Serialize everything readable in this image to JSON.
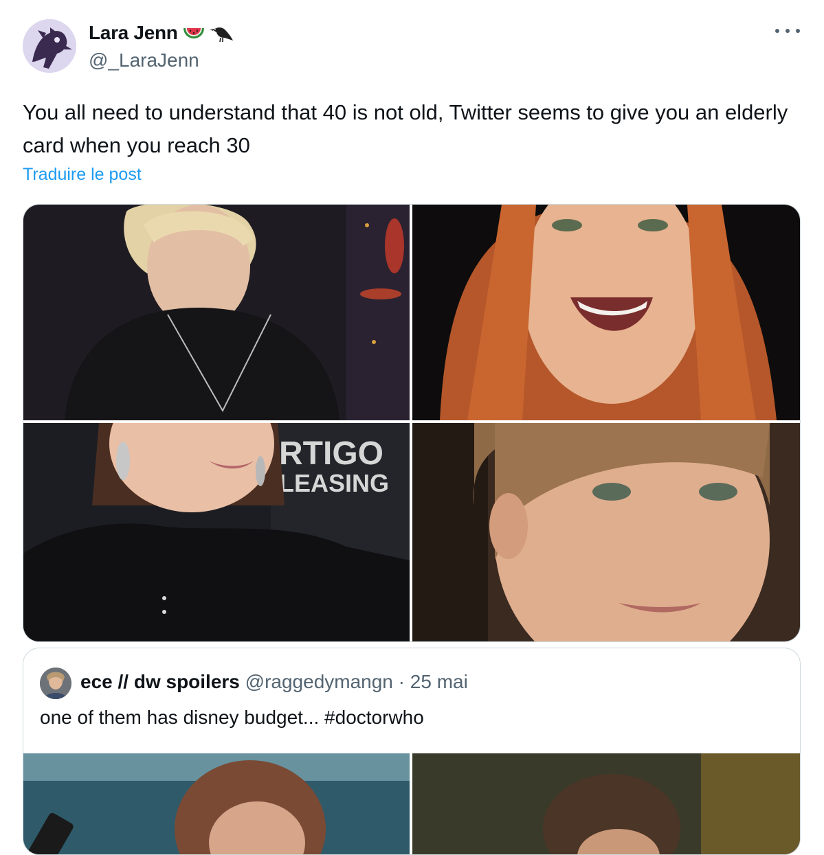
{
  "author": {
    "name": "Lara Jenn",
    "handle": "@_LaraJenn",
    "name_emojis": [
      "watermelon-icon",
      "crow-icon"
    ]
  },
  "tweet": {
    "text": "You all need to understand that 40 is not old, Twitter seems to give you an elderly card when you reach 30",
    "translate_label": "Traduire le post"
  },
  "media": {
    "photo_3_sign_text": [
      "RTIGO",
      "LEASING"
    ]
  },
  "quote": {
    "name": "ece // dw spoilers",
    "handle": "@raggedymangn",
    "separator": "·",
    "date": "25 mai",
    "text": "one of them has disney budget... #doctorwho"
  },
  "colors": {
    "link": "#1d9bf0",
    "secondary_text": "#536471",
    "border": "#cfd9de"
  }
}
